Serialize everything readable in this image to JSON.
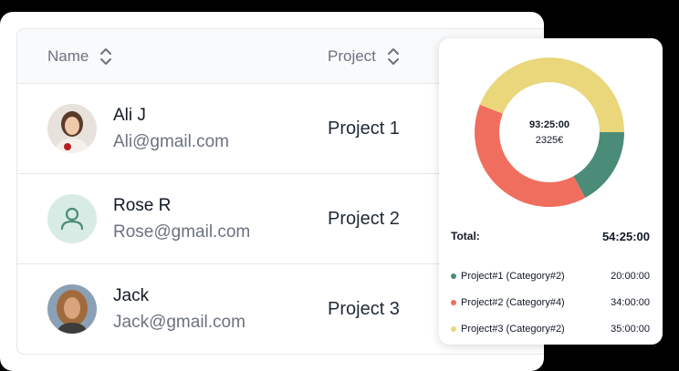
{
  "table": {
    "headers": {
      "name": "Name",
      "project": "Project"
    },
    "rows": [
      {
        "name": " Ali J",
        "email": "Ali@gmail.com",
        "project": "Project 1",
        "avatar": "photo-woman-icon"
      },
      {
        "name": "Rose R",
        "email": "Rose@gmail.com",
        "project": "Project 2",
        "avatar": "user-icon"
      },
      {
        "name": "Jack",
        "email": "Jack@gmail.com",
        "project": "Project 3",
        "avatar": "photo-woman-icon"
      }
    ]
  },
  "summary": {
    "center_time": "93:25:00",
    "center_money": "2325€",
    "total_label": "Total:",
    "total_value": "54:25:00",
    "legend": [
      {
        "label": "Project#1 (Category#2)",
        "value": "20:00:00",
        "color": "#4a8c78"
      },
      {
        "label": "Project#2 (Category#4)",
        "value": "34:00:00",
        "color": "#f06e5e"
      },
      {
        "label": "Project#3 (Category#2)",
        "value": "35:00:00",
        "color": "#ead67b"
      }
    ]
  },
  "colors": {
    "donut_green": "#4a8c78",
    "donut_red": "#f06e5e",
    "donut_yellow": "#ead67b"
  }
}
